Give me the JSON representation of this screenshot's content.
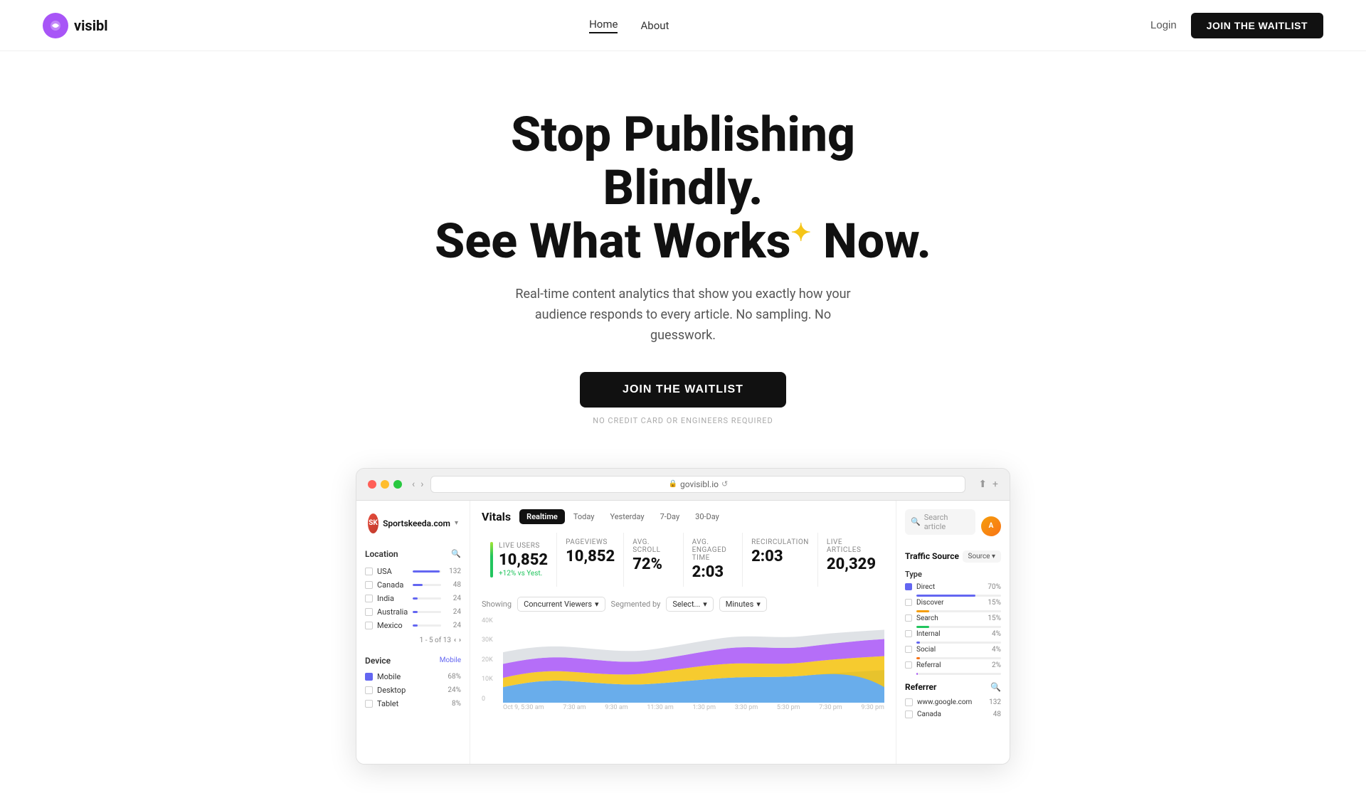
{
  "nav": {
    "logo_text": "visibl",
    "links": [
      {
        "label": "Home",
        "active": true
      },
      {
        "label": "About",
        "active": false
      }
    ],
    "login_label": "Login",
    "waitlist_label": "JOIN THE WAITLIST"
  },
  "hero": {
    "line1": "Stop Publishing Blindly.",
    "line2": "See What Works Now.",
    "sparkle": "✦",
    "description": "Real-time content analytics that show you exactly how your audience responds to every article. No sampling. No guesswork.",
    "cta_label": "JOIN THE WAITLIST",
    "sub_label": "NO CREDIT CARD OR ENGINEERS REQUIRED"
  },
  "browser": {
    "url": "govisibl.io"
  },
  "app": {
    "site_name": "Sportskeeda.com",
    "site_initials": "SK",
    "user_initials": "A",
    "location_title": "Location",
    "filters": [
      {
        "name": "USA",
        "count": 132,
        "pct": 95
      },
      {
        "name": "Canada",
        "count": 48,
        "pct": 36
      },
      {
        "name": "India",
        "count": 24,
        "pct": 18
      },
      {
        "name": "Australia",
        "count": 24,
        "pct": 18
      },
      {
        "name": "Mexico",
        "count": 24,
        "pct": 18
      }
    ],
    "pagination": "1 - 5 of 13",
    "device_title": "Device",
    "devices": [
      {
        "name": "Mobile",
        "count": "68%",
        "checked": true
      },
      {
        "name": "Desktop",
        "count": "24%",
        "checked": false
      },
      {
        "name": "Tablet",
        "count": "8%",
        "checked": false
      }
    ],
    "vitals_title": "Vitals",
    "tabs": [
      "Realtime",
      "Today",
      "Yesterday",
      "7-Day",
      "30-Day"
    ],
    "active_tab": "Realtime",
    "metrics": [
      {
        "label": "LIVE USERS",
        "value": "10,852",
        "sub": "+12% vs Yest."
      },
      {
        "label": "PAGEVIEWS",
        "value": "10,852",
        "sub": ""
      },
      {
        "label": "AVG. SCROLL",
        "value": "72%",
        "sub": ""
      },
      {
        "label": "AVG. ENGAGED TIME",
        "value": "2:03",
        "sub": ""
      },
      {
        "label": "RECIRCULATION",
        "value": "2:03",
        "sub": ""
      },
      {
        "label": "LIVE ARTICLES",
        "value": "20,329",
        "sub": ""
      }
    ],
    "chart_showing": "Showing",
    "chart_dropdown1": "Concurrent Viewers",
    "chart_segmented": "Segmented by",
    "chart_dropdown2": "Select...",
    "chart_dropdown3": "Minutes",
    "x_labels": [
      "Oct 9, 5:30 am",
      "7:30 am",
      "9:30 am",
      "11:30 am",
      "1:30 pm",
      "3:30 pm",
      "5:30 pm",
      "7:30 pm",
      "9:30 pm"
    ],
    "y_labels": [
      "40K",
      "30K",
      "20K",
      "10K",
      "0"
    ],
    "traffic_source_title": "Traffic Source",
    "search_article_placeholder": "Search article",
    "type_label": "Type",
    "traffic_types": [
      {
        "name": "Direct",
        "pct": "70%",
        "checked": true,
        "color": "#6366f1",
        "fill_pct": 70
      },
      {
        "name": "Discover",
        "pct": "15%",
        "checked": false,
        "color": "#f59e0b",
        "fill_pct": 15
      },
      {
        "name": "Search",
        "pct": "15%",
        "checked": false,
        "color": "#22c55e",
        "fill_pct": 15
      },
      {
        "name": "Internal",
        "pct": "4%",
        "checked": false,
        "color": "#6366f1",
        "fill_pct": 4
      },
      {
        "name": "Social",
        "pct": "4%",
        "checked": false,
        "color": "#f97316",
        "fill_pct": 4
      },
      {
        "name": "Referral",
        "pct": "2%",
        "checked": false,
        "color": "#6366f1",
        "fill_pct": 2
      }
    ],
    "referrer_title": "Referrer",
    "referrers": [
      {
        "name": "www.google.com",
        "count": 132
      },
      {
        "name": "Canada",
        "count": 48
      }
    ]
  }
}
